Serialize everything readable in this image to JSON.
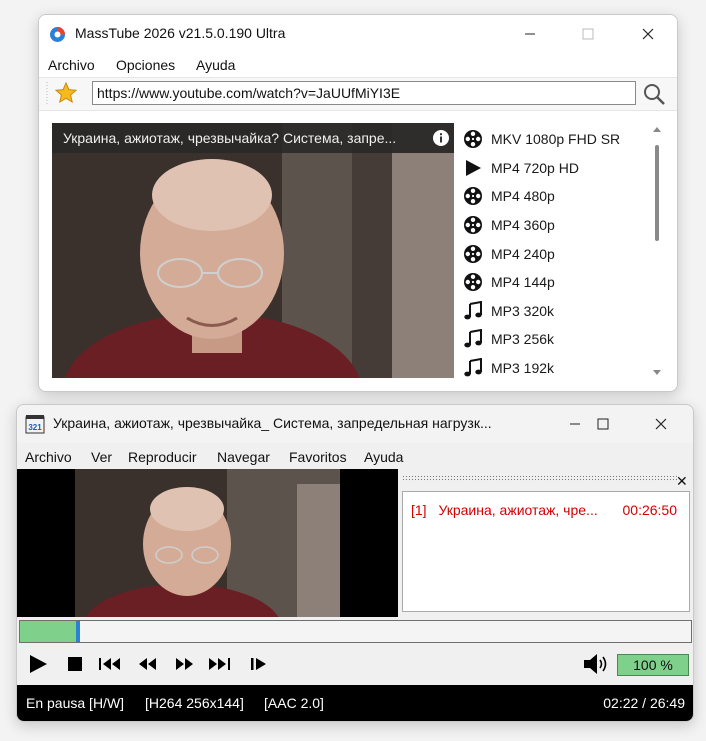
{
  "masstube": {
    "title": "MassTube 2026 v21.5.0.190 Ultra",
    "menu": [
      "Archivo",
      "Opciones",
      "Ayuda"
    ],
    "url": "https://www.youtube.com/watch?v=JaUUfMiYI3E",
    "video_title": "Украина, ажиотаж, чрезвычайка? Система, запре...",
    "formats": [
      {
        "label": "MKV 1080p FHD SR",
        "icon": "film-reel-icon"
      },
      {
        "label": "MP4 720p HD",
        "icon": "play-icon"
      },
      {
        "label": "MP4 480p",
        "icon": "film-reel-icon"
      },
      {
        "label": "MP4 360p",
        "icon": "film-reel-icon"
      },
      {
        "label": "MP4 240p",
        "icon": "film-reel-icon"
      },
      {
        "label": "MP4 144p",
        "icon": "film-reel-icon"
      },
      {
        "label": "MP3 320k",
        "icon": "music-note-icon"
      },
      {
        "label": "MP3 256k",
        "icon": "music-note-icon"
      },
      {
        "label": "MP3 192k",
        "icon": "music-note-icon"
      }
    ]
  },
  "player": {
    "title": "Украина, ажиотаж, чрезвычайка_ Система, запредельная нагрузк...",
    "menu": [
      "Archivo",
      "Ver",
      "Reproducir",
      "Navegar",
      "Favoritos",
      "Ayuda"
    ],
    "playlist": {
      "index": "[1]",
      "title": "Украина, ажиотаж, чре...",
      "duration": "00:26:50"
    },
    "seek_progress": 0.083,
    "volume": "100 %",
    "status": {
      "state": "En pausa [H/W]",
      "video": "[H264 256x144]",
      "audio": "[AAC 2.0]",
      "time": "02:22 / 26:49"
    }
  },
  "colors": {
    "accent_green": "#7ed08a",
    "seek_thumb": "#2a82d6",
    "playlist_text": "#d40000"
  }
}
